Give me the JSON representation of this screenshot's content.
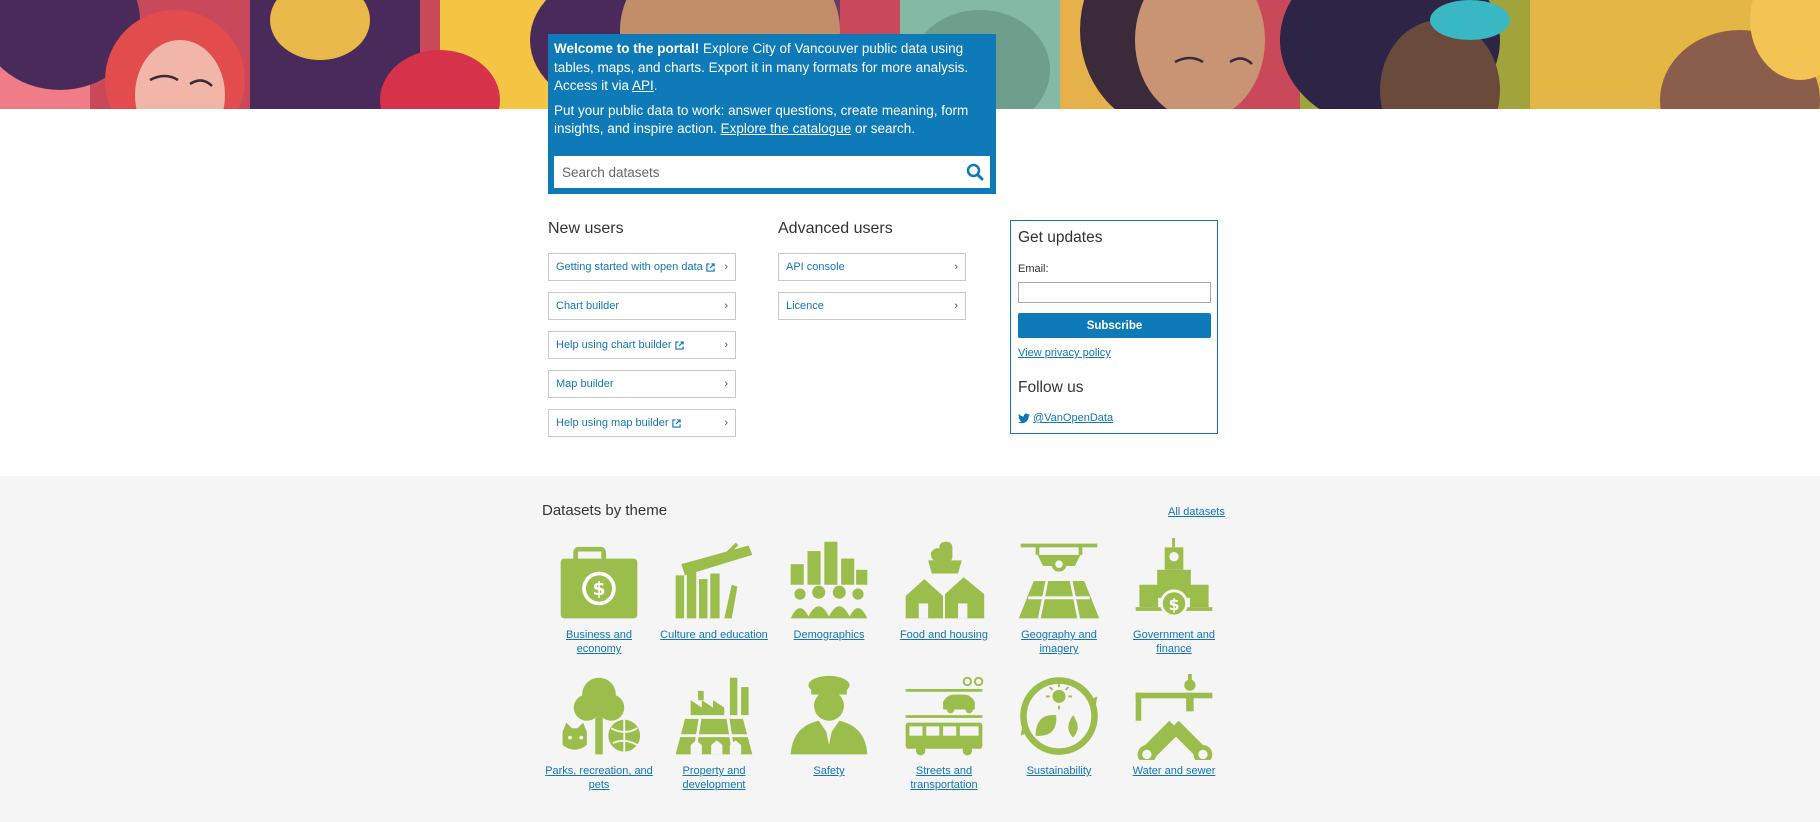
{
  "welcome": {
    "bold": "Welcome to the portal!",
    "intro": " Explore City of Vancouver public data using tables, maps, and charts. Export it in many formats for more analysis. Access it via ",
    "api_link": "API",
    "intro_end": ".",
    "second": "Put your public data to work: answer questions, create meaning, form insights, and inspire action. ",
    "catalogue_link": "Explore the catalogue",
    "second_end": " or search.",
    "search_placeholder": "Search datasets"
  },
  "new_users": {
    "title": "New users",
    "links": [
      {
        "label": "Getting started with open data",
        "external": true
      },
      {
        "label": "Chart builder",
        "external": false
      },
      {
        "label": "Help using chart builder",
        "external": true
      },
      {
        "label": "Map builder",
        "external": false
      },
      {
        "label": "Help using map builder",
        "external": true
      }
    ]
  },
  "advanced_users": {
    "title": "Advanced users",
    "links": [
      {
        "label": "API console",
        "external": false
      },
      {
        "label": "Licence",
        "external": false
      }
    ]
  },
  "updates": {
    "title": "Get updates",
    "email_label": "Email:",
    "subscribe": "Subscribe",
    "privacy": "View privacy policy",
    "follow": "Follow us",
    "twitter": "@VanOpenData"
  },
  "themes": {
    "title": "Datasets by theme",
    "all": "All datasets",
    "items": [
      {
        "label": "Business and economy",
        "icon": "briefcase-icon"
      },
      {
        "label": "Culture and education",
        "icon": "books-icon"
      },
      {
        "label": "Demographics",
        "icon": "people-chart-icon"
      },
      {
        "label": "Food and housing",
        "icon": "houses-icon"
      },
      {
        "label": "Geography and imagery",
        "icon": "drone-map-icon"
      },
      {
        "label": "Government and finance",
        "icon": "city-hall-icon"
      },
      {
        "label": "Parks, recreation, and pets",
        "icon": "tree-dog-icon"
      },
      {
        "label": "Property and development",
        "icon": "factory-icon"
      },
      {
        "label": "Safety",
        "icon": "officer-icon"
      },
      {
        "label": "Streets and transportation",
        "icon": "bus-icon"
      },
      {
        "label": "Sustainability",
        "icon": "recycle-leaf-icon"
      },
      {
        "label": "Water and sewer",
        "icon": "pipes-icon"
      }
    ]
  },
  "colors": {
    "brand_blue": "#0f7ab8",
    "link_blue": "#1276b6",
    "theme_green": "#9bbd4b",
    "section_gray": "#f5f5f5"
  }
}
